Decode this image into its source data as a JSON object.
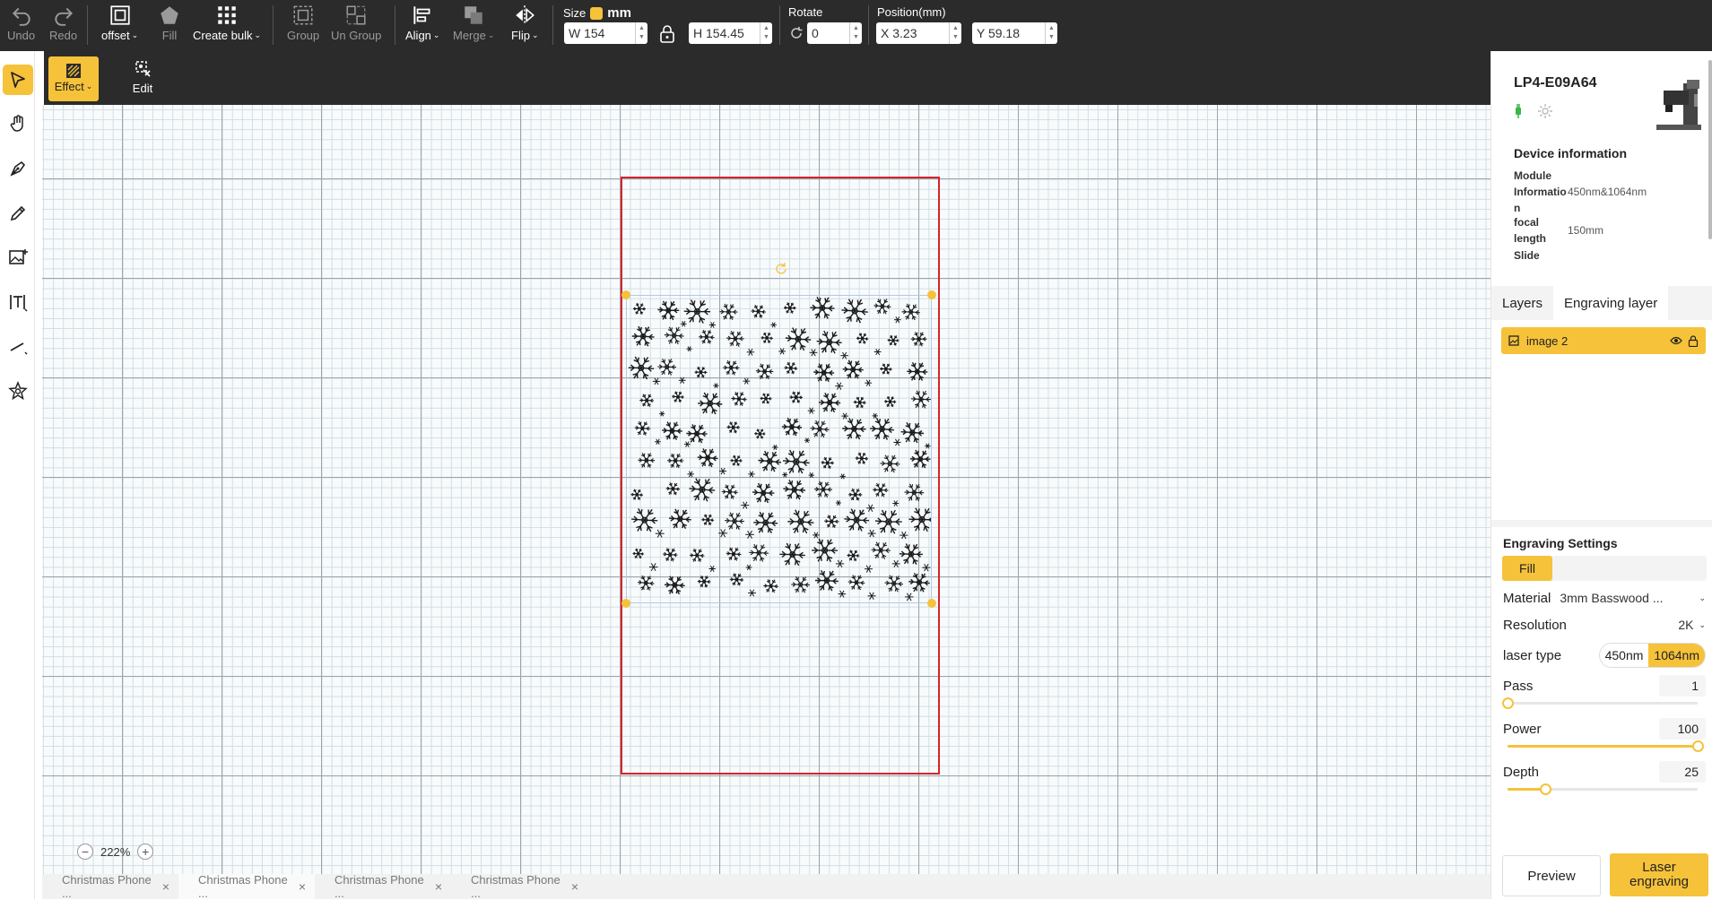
{
  "toolbar": {
    "undo": "Undo",
    "redo": "Redo",
    "offset": "offset",
    "fill": "Fill",
    "create_bulk": "Create bulk",
    "group": "Group",
    "ungroup": "Un Group",
    "align": "Align",
    "merge": "Merge",
    "flip": "Flip",
    "size_label": "Size",
    "unit": "mm",
    "width": "W 154",
    "height": "H 154.45",
    "rotate_label": "Rotate",
    "rotate_value": "0",
    "position_label": "Position(mm)",
    "pos_x": "X 3.23",
    "pos_y": "Y 59.18"
  },
  "subbar": {
    "effect": "Effect",
    "edit": "Edit"
  },
  "left_tools": [
    "select-icon",
    "hand-icon",
    "pen-tool-icon",
    "pencil-icon",
    "add-image-icon",
    "text-icon",
    "line-icon",
    "magic-shapes-icon"
  ],
  "canvas": {
    "zoom": "222%",
    "zoom_minus": "−",
    "zoom_plus": "+"
  },
  "file_tabs": [
    {
      "label": "Christmas Phone ...",
      "close": "×"
    },
    {
      "label": "Christmas Phone ...",
      "close": "×"
    },
    {
      "label": "Christmas Phone ...",
      "close": "×"
    },
    {
      "label": "Christmas Phone ...",
      "close": "×"
    }
  ],
  "device": {
    "name": "LP4-E09A64",
    "title": "Device information",
    "rows": [
      {
        "key": "Module Informatio n",
        "value": "450nm&1064nm"
      },
      {
        "key": "focal length",
        "value": "150mm"
      },
      {
        "key": "Slide",
        "value": ""
      }
    ]
  },
  "layers": {
    "tabs": [
      "Layers",
      "Engraving layer"
    ],
    "items": [
      {
        "name": "image 2"
      }
    ]
  },
  "engraving": {
    "title": "Engraving Settings",
    "mode": "Fill",
    "material_label": "Material",
    "material_value": "3mm Basswood ...",
    "resolution_label": "Resolution",
    "resolution_value": "2K",
    "laser_label": "laser type",
    "laser_options": [
      "450nm",
      "1064nm"
    ],
    "laser_selected": "1064nm",
    "pass_label": "Pass",
    "pass_value": "1",
    "pass_level": 0.0,
    "power_label": "Power",
    "power_value": "100",
    "power_level": 1.0,
    "depth_label": "Depth",
    "depth_value": "25",
    "depth_level": 0.2,
    "preview": "Preview",
    "laser_engraving": "Laser\nengraving"
  },
  "colors": {
    "accent": "#f6c23a",
    "toolbar": "#2b2b2b",
    "workarea_border": "#d8232a"
  }
}
